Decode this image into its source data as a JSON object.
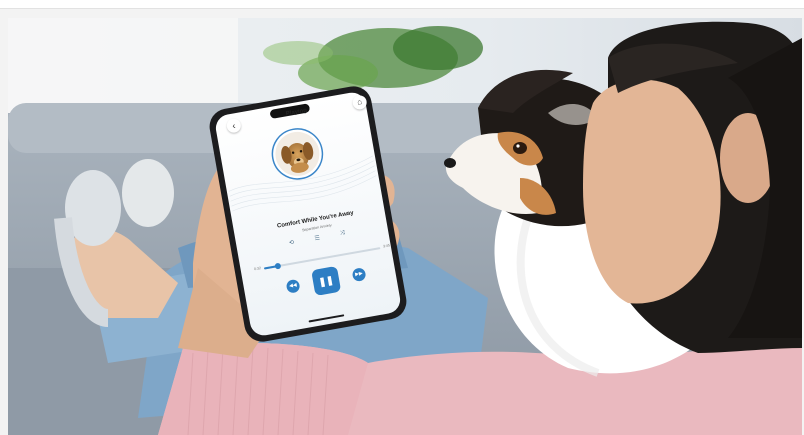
{
  "player": {
    "title": "Playing",
    "song": "Comfort While You're Away",
    "artist": "Separation Anxiety",
    "time_elapsed": "0:32",
    "time_total": "3:45",
    "progress": 0.12,
    "icons": {
      "back": "chevron-left-icon",
      "home": "home-icon",
      "repeat": "repeat-icon",
      "queue": "queue-icon",
      "shuffle": "shuffle-icon",
      "prev": "rewind-icon",
      "play": "pause-icon",
      "next": "forward-icon"
    }
  },
  "colors": {
    "accent": "#2d7ec4",
    "sweater": "#eab9bf",
    "sofa": "#9aa6b2",
    "jeans": "#7fa6c8"
  }
}
